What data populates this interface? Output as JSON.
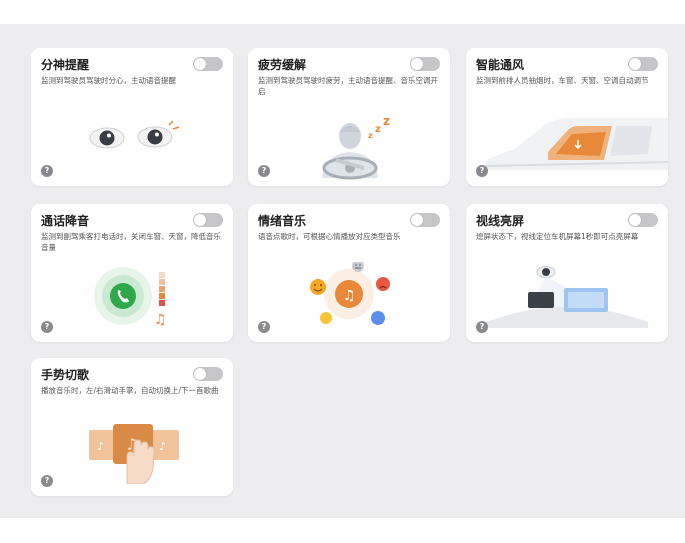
{
  "cards": [
    {
      "title": "分神提醒",
      "desc": "监测到驾驶员驾驶时分心，主动语音提醒",
      "toggle_on": false,
      "help": "?",
      "icon": "eyes-illustration"
    },
    {
      "title": "疲劳缓解",
      "desc": "监测到驾驶员驾驶时疲劳，主动语音提醒、音乐空调开启",
      "toggle_on": false,
      "help": "?",
      "icon": "sleepy-driver-illustration",
      "zzz": "Z Z Z"
    },
    {
      "title": "智能通风",
      "desc": "监测到前排人员抽烟时，车窗、天窗、空调自动调节",
      "toggle_on": false,
      "help": "?",
      "icon": "car-window-illustration"
    },
    {
      "title": "通话降音",
      "desc": "监测到副驾乘客打电话时，关闭车窗、天窗，降低音乐音量",
      "toggle_on": false,
      "help": "?",
      "icon": "phone-call-illustration"
    },
    {
      "title": "情绪音乐",
      "desc": "语音点歌时，可根据心情播放对应类型音乐",
      "toggle_on": false,
      "help": "?",
      "icon": "mood-music-illustration"
    },
    {
      "title": "视线亮屏",
      "desc": "熄屏状态下，视线定位车机屏幕1秒即可点亮屏幕",
      "toggle_on": false,
      "help": "?",
      "icon": "gaze-screen-illustration"
    },
    {
      "title": "手势切歌",
      "desc": "播放音乐时，左/右滑动手掌，自动切换上/下一首歌曲",
      "toggle_on": false,
      "help": "?",
      "icon": "hand-swipe-illustration"
    }
  ],
  "colors": {
    "background": "#ededf0",
    "card": "#ffffff",
    "toggle_off": "#c6c6c9",
    "accent_orange": "#e8893a",
    "call_green": "#2ea84a"
  }
}
